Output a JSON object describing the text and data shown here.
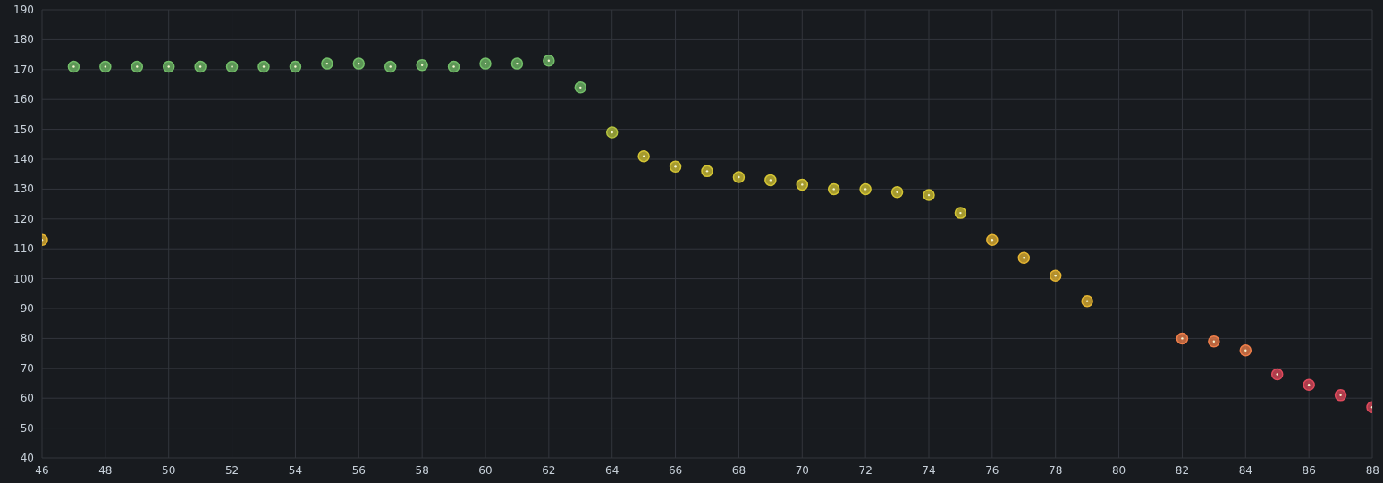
{
  "chart_data": {
    "type": "scatter",
    "grid": true,
    "x": [
      46,
      47,
      48,
      49,
      50,
      51,
      52,
      53,
      54,
      55,
      56,
      57,
      58,
      59,
      60,
      61,
      62,
      63,
      64,
      65,
      66,
      67,
      68,
      69,
      70,
      71,
      72,
      73,
      74,
      75,
      76,
      77,
      78,
      79,
      82,
      83,
      84,
      85,
      86,
      87,
      88
    ],
    "series": [
      {
        "color": "#73bf69",
        "values": [
          null,
          171,
          171,
          171,
          171,
          171,
          171,
          171,
          171,
          172,
          172,
          171,
          171.5,
          171,
          172,
          172,
          173,
          164,
          null,
          null,
          null,
          null,
          null,
          null,
          null,
          null,
          null,
          null,
          null,
          null,
          null,
          null,
          null,
          null,
          null,
          null,
          null,
          null,
          null,
          null,
          null
        ]
      },
      {
        "color": "#b4c23e",
        "values": [
          null,
          null,
          null,
          null,
          null,
          null,
          null,
          null,
          null,
          null,
          null,
          null,
          null,
          null,
          null,
          null,
          null,
          null,
          149,
          null,
          null,
          null,
          null,
          null,
          null,
          null,
          null,
          null,
          null,
          null,
          null,
          null,
          null,
          null,
          null,
          null,
          null,
          null,
          null,
          null,
          null
        ]
      },
      {
        "color": "#d4c534",
        "values": [
          null,
          null,
          null,
          null,
          null,
          null,
          null,
          null,
          null,
          null,
          null,
          null,
          null,
          null,
          null,
          null,
          null,
          null,
          null,
          141,
          137.5,
          136,
          134,
          133,
          131.5,
          130,
          130,
          129,
          128,
          122,
          null,
          null,
          null,
          null,
          null,
          null,
          null,
          null,
          null,
          null,
          null
        ]
      },
      {
        "color": "#e5b532",
        "values": [
          113,
          null,
          null,
          null,
          null,
          null,
          null,
          null,
          null,
          null,
          null,
          null,
          null,
          null,
          null,
          null,
          null,
          null,
          null,
          null,
          null,
          null,
          null,
          null,
          null,
          null,
          null,
          null,
          null,
          null,
          113,
          107,
          101,
          92.5,
          null,
          null,
          null,
          null,
          null,
          null,
          null
        ]
      },
      {
        "color": "#f07f4a",
        "values": [
          null,
          null,
          null,
          null,
          null,
          null,
          null,
          null,
          null,
          null,
          null,
          null,
          null,
          null,
          null,
          null,
          null,
          null,
          null,
          null,
          null,
          null,
          null,
          null,
          null,
          null,
          null,
          null,
          null,
          null,
          null,
          null,
          null,
          null,
          80,
          79,
          76,
          null,
          null,
          null,
          null
        ]
      },
      {
        "color": "#e04a5c",
        "values": [
          null,
          null,
          null,
          null,
          null,
          null,
          null,
          null,
          null,
          null,
          null,
          null,
          null,
          null,
          null,
          null,
          null,
          null,
          null,
          null,
          null,
          null,
          null,
          null,
          null,
          null,
          null,
          null,
          null,
          null,
          null,
          null,
          null,
          null,
          null,
          null,
          null,
          68,
          64.5,
          61,
          57
        ]
      }
    ],
    "xlim": [
      46,
      88
    ],
    "ylim": [
      40,
      190
    ],
    "xticks": [
      46,
      48,
      50,
      52,
      54,
      56,
      58,
      60,
      62,
      64,
      66,
      68,
      70,
      72,
      74,
      76,
      78,
      80,
      82,
      84,
      86,
      88
    ],
    "yticks": [
      40,
      50,
      60,
      70,
      80,
      90,
      100,
      110,
      120,
      130,
      140,
      150,
      160,
      170,
      180,
      190
    ]
  }
}
